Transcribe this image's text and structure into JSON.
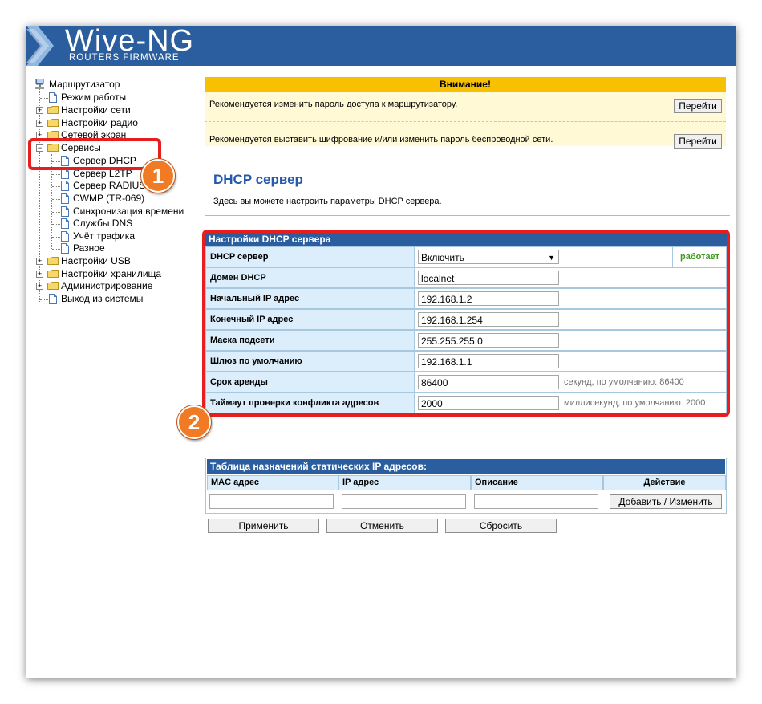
{
  "logo": {
    "title": "Wive-NG",
    "subtitle": "ROUTERS FIRMWARE"
  },
  "tree": {
    "root": "Маршрутизатор",
    "items": [
      {
        "label": "Режим работы"
      },
      {
        "label": "Настройки сети"
      },
      {
        "label": "Настройки радио"
      },
      {
        "label": "Сетевой экран"
      },
      {
        "label": "Сервисы"
      },
      {
        "label": "Сервер DHCP"
      },
      {
        "label": "Сервер L2TP"
      },
      {
        "label": "Сервер RADIUS"
      },
      {
        "label": "CWMP (TR-069)"
      },
      {
        "label": "Синхронизация времени"
      },
      {
        "label": "Службы DNS"
      },
      {
        "label": "Учёт трафика"
      },
      {
        "label": "Разное"
      },
      {
        "label": "Настройки USB"
      },
      {
        "label": "Настройки хранилища"
      },
      {
        "label": "Администрирование"
      },
      {
        "label": "Выход из системы"
      }
    ]
  },
  "warning": {
    "title": "Внимание!",
    "rows": [
      {
        "text": "Рекомендуется изменить пароль доступа к маршрутизатору.",
        "button": "Перейти"
      },
      {
        "text": "Рекомендуется выставить шифрование и/или изменить пароль беспроводной сети.",
        "button": "Перейти"
      }
    ]
  },
  "page": {
    "title": "DHCP сервер",
    "description": "Здесь вы можете настроить параметры DHCP сервера."
  },
  "settings": {
    "header": "Настройки DHCP сервера",
    "rows": [
      {
        "label": "DHCP сервер",
        "value": "Включить",
        "status": "работает"
      },
      {
        "label": "Домен DHCP",
        "value": "localnet"
      },
      {
        "label": "Начальный IP адрес",
        "value": "192.168.1.2"
      },
      {
        "label": "Конечный IP адрес",
        "value": "192.168.1.254"
      },
      {
        "label": "Маска подсети",
        "value": "255.255.255.0"
      },
      {
        "label": "Шлюз по умолчанию",
        "value": "192.168.1.1"
      },
      {
        "label": "Срок аренды",
        "value": "86400",
        "hint": "секунд, по умолчанию: 86400"
      },
      {
        "label": "Таймаут проверки конфликта адресов",
        "value": "2000",
        "hint": "миллисекунд, по умолчанию: 2000"
      }
    ]
  },
  "static_table": {
    "header": "Таблица назначений статических IP адресов:",
    "columns": [
      "MAC адрес",
      "IP адрес",
      "Описание",
      "Действие"
    ],
    "add_button": "Добавить / Изменить"
  },
  "actions": {
    "apply": "Применить",
    "cancel": "Отменить",
    "reset": "Сбросить"
  },
  "annotations": {
    "badge1": "1",
    "badge2": "2"
  },
  "colors": {
    "header_blue": "#2b5e9e",
    "warning_yellow": "#f7c000",
    "status_green": "#3a9a1a",
    "annotation_red": "#e81e1e",
    "badge_orange": "#f07b24"
  }
}
